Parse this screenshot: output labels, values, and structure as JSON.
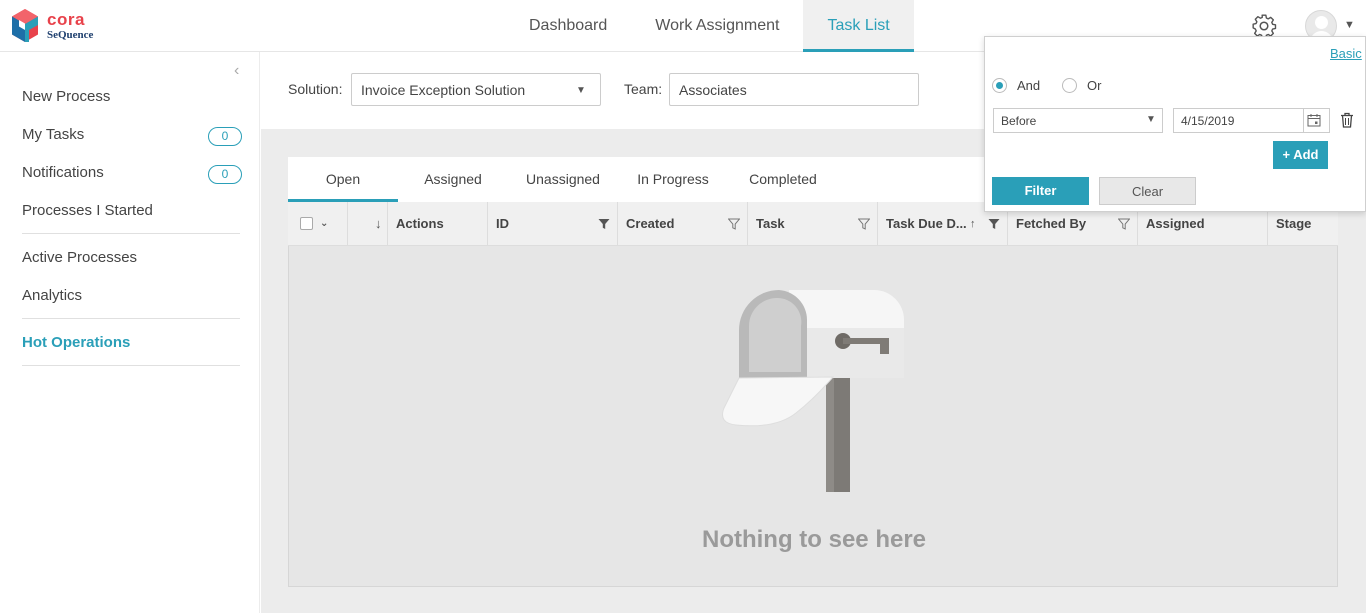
{
  "app": {
    "logo_line1": "cora",
    "logo_line2": "SeQuence"
  },
  "nav": {
    "tabs": [
      {
        "label": "Dashboard"
      },
      {
        "label": "Work Assignment"
      },
      {
        "label": "Task List",
        "active": true
      }
    ]
  },
  "sidebar": {
    "items": [
      {
        "label": "New Process"
      },
      {
        "label": "My Tasks",
        "badge": "0"
      },
      {
        "label": "Notifications",
        "badge": "0"
      },
      {
        "label": "Processes I Started"
      },
      {
        "label": "Active Processes"
      },
      {
        "label": "Analytics"
      },
      {
        "label": "Hot Operations",
        "active": true
      }
    ]
  },
  "filters": {
    "solution_label": "Solution:",
    "solution_value": "Invoice Exception Solution",
    "team_label": "Team:",
    "team_value": "Associates"
  },
  "task_tabs": [
    {
      "label": "Open",
      "active": true
    },
    {
      "label": "Assigned"
    },
    {
      "label": "Unassigned"
    },
    {
      "label": "In Progress"
    },
    {
      "label": "Completed"
    }
  ],
  "grid": {
    "columns": [
      {
        "label": "Actions"
      },
      {
        "label": "ID"
      },
      {
        "label": "Created"
      },
      {
        "label": "Task"
      },
      {
        "label": "Task Due D..."
      },
      {
        "label": "Fetched By"
      },
      {
        "label": "Assigned"
      },
      {
        "label": "Stage"
      }
    ],
    "empty_message": "Nothing to see here"
  },
  "advanced_filter": {
    "basic_link": "Basic",
    "and_label": "And",
    "or_label": "Or",
    "selected_logic": "And",
    "operator_value": "Before",
    "date_value": "4/15/2019",
    "add_label": "+ Add",
    "filter_label": "Filter",
    "clear_label": "Clear"
  },
  "colors": {
    "accent": "#2a9fb8",
    "logo_red": "#e8424b",
    "logo_navy": "#1e3f6e"
  }
}
